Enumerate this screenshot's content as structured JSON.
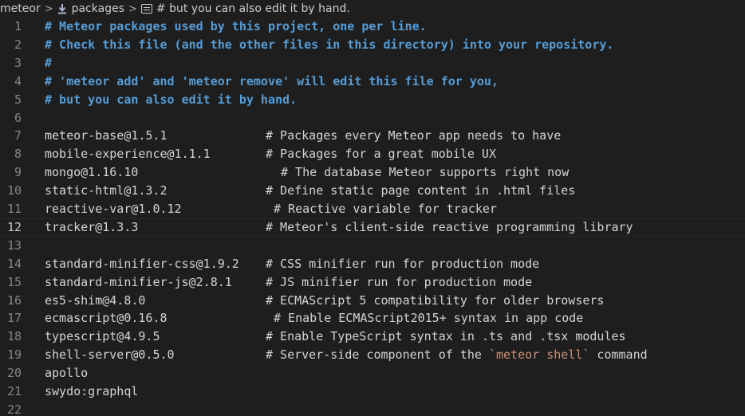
{
  "breadcrumb": {
    "root": "meteor",
    "folder": "packages",
    "symbol": "# but you can also edit it by hand.",
    "separator": ">"
  },
  "editor": {
    "current_line": 12,
    "lines": [
      {
        "n": "1",
        "header": "# Meteor packages used by this project, one per line."
      },
      {
        "n": "2",
        "header": "# Check this file (and the other files in this directory) into your repository."
      },
      {
        "n": "3",
        "header": "#"
      },
      {
        "n": "4",
        "header": "# 'meteor add' and 'meteor remove' will edit this file for you,"
      },
      {
        "n": "5",
        "header": "# but you can also edit it by hand."
      },
      {
        "n": "6"
      },
      {
        "n": "7",
        "package": "meteor-base@1.5.1",
        "comment": "# Packages every Meteor app needs to have"
      },
      {
        "n": "8",
        "package": "mobile-experience@1.1.1",
        "comment": "# Packages for a great mobile UX"
      },
      {
        "n": "9",
        "package": "mongo@1.16.10",
        "comment": "# The database Meteor supports right now"
      },
      {
        "n": "10",
        "package": "static-html@1.3.2",
        "comment": "# Define static page content in .html files"
      },
      {
        "n": "11",
        "package": "reactive-var@1.0.12",
        "comment": "# Reactive variable for tracker"
      },
      {
        "n": "12",
        "package": "tracker@1.3.3",
        "comment": "# Meteor's client-side reactive programming library"
      },
      {
        "n": "13"
      },
      {
        "n": "14",
        "package": "standard-minifier-css@1.9.2",
        "comment": "# CSS minifier run for production mode"
      },
      {
        "n": "15",
        "package": "standard-minifier-js@2.8.1",
        "comment": "# JS minifier run for production mode"
      },
      {
        "n": "16",
        "package": "es5-shim@4.8.0",
        "comment": "# ECMAScript 5 compatibility for older browsers"
      },
      {
        "n": "17",
        "package": "ecmascript@0.16.8",
        "comment": "# Enable ECMAScript2015+ syntax in app code"
      },
      {
        "n": "18",
        "package": "typescript@4.9.5",
        "comment": "# Enable TypeScript syntax in .ts and .tsx modules"
      },
      {
        "n": "19",
        "package": "shell-server@0.5.0",
        "comment_pre": "# Server-side component of the ",
        "comment_code": "`meteor shell`",
        "comment_post": " command"
      },
      {
        "n": "20",
        "package": "apollo"
      },
      {
        "n": "21",
        "package": "swydo:graphql"
      },
      {
        "n": "22"
      }
    ]
  },
  "colors": {
    "background": "#1e1e1e",
    "header_comment": "#569cd6",
    "text": "#d4d4d4",
    "string": "#ce9178",
    "line_number": "#858585"
  }
}
